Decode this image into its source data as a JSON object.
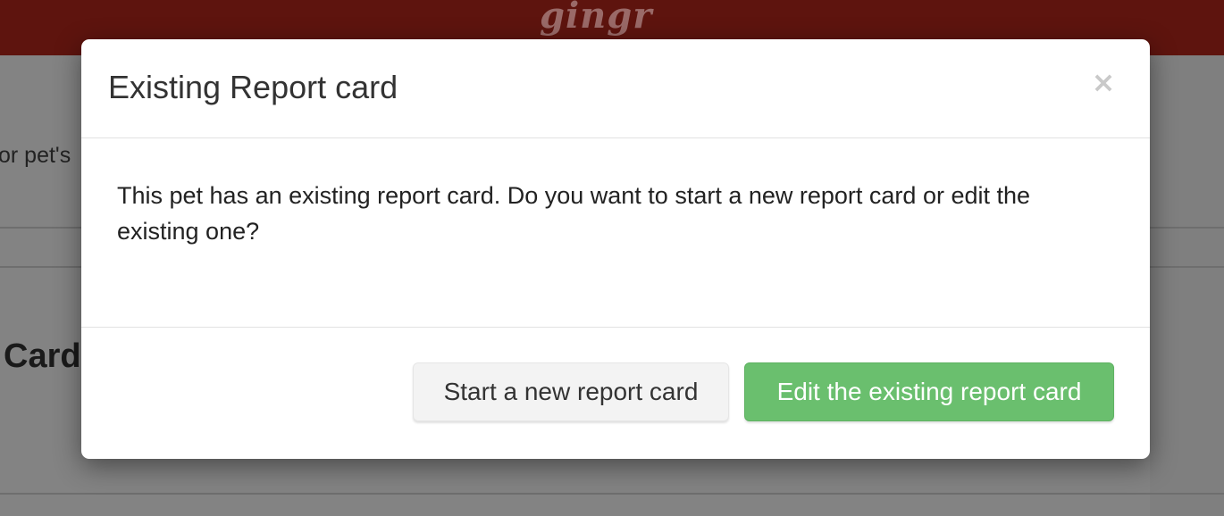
{
  "app": {
    "logo_text": "gingr",
    "brand_color": "#5e140e"
  },
  "background": {
    "text_fragment_1": "or pet's",
    "text_fragment_2": "Card"
  },
  "modal": {
    "title": "Existing Report card",
    "close_symbol": "×",
    "close_icon": "close-icon",
    "message": "This pet has an existing report card. Do you want to start a new report card or edit the existing one?",
    "buttons": {
      "start_new_label": "Start a new report card",
      "edit_existing_label": "Edit the existing report card"
    },
    "colors": {
      "primary_button": "#6abf6e",
      "secondary_button": "#f3f3f3"
    }
  }
}
